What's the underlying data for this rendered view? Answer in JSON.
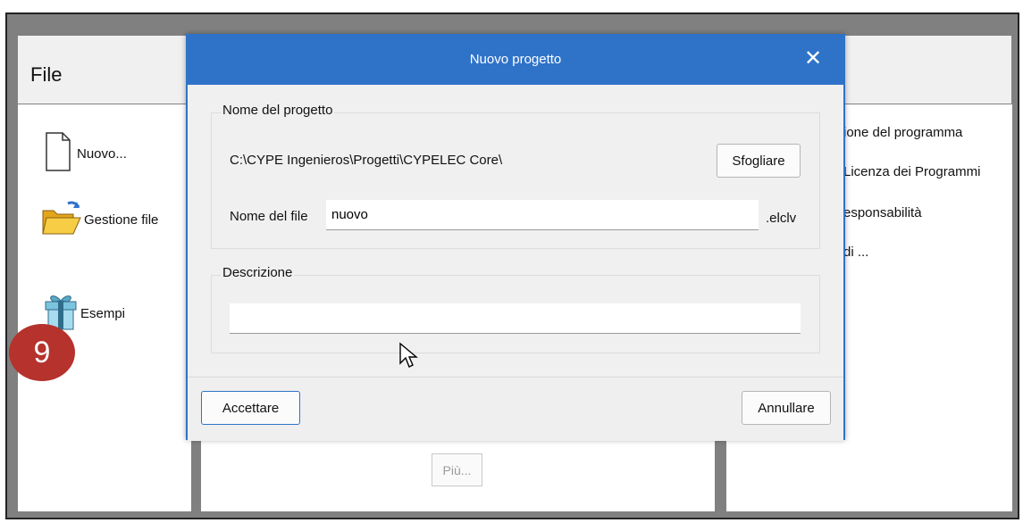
{
  "file_panel": {
    "title": "File",
    "items": [
      {
        "label": "Nuovo...",
        "icon": "new-document-icon"
      },
      {
        "label": "Gestione file",
        "icon": "folder-open-icon"
      },
      {
        "label": "Esempi",
        "icon": "gift-box-icon"
      }
    ]
  },
  "step_badge": "9",
  "middle_panel": {
    "more_button": "Più..."
  },
  "right_panel": {
    "links": [
      "ione del programma",
      "Licenza dei Programmi",
      "esponsabilità",
      "di ..."
    ]
  },
  "dialog": {
    "title": "Nuovo progetto",
    "close_icon": "close-icon",
    "project_group": {
      "legend": "Nome del progetto",
      "path": "C:\\CYPE Ingenieros\\Progetti\\CYPELEC Core\\",
      "browse_button": "Sfogliare",
      "filename_label": "Nome del file",
      "filename_value": "nuovo",
      "extension": ".elclv"
    },
    "description_group": {
      "legend": "Descrizione",
      "value": ""
    },
    "accept_button": "Accettare",
    "cancel_button": "Annullare"
  },
  "colors": {
    "titlebar": "#2f73c9",
    "badge": "#b5322d",
    "backdrop": "#808080"
  }
}
